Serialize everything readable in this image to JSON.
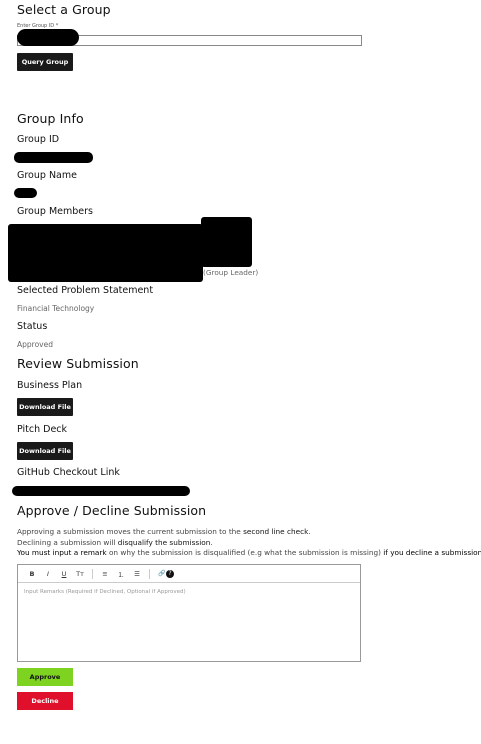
{
  "select_group": {
    "title": "Select a Group",
    "input_label": "Enter Group ID *",
    "query_button": "Query Group"
  },
  "group_info": {
    "title": "Group Info",
    "group_id_label": "Group ID",
    "group_name_label": "Group Name",
    "members_label": "Group Members",
    "leader_tag": "(Group Leader)",
    "problem_label": "Selected Problem Statement",
    "problem_value": "Financial Technology",
    "status_label": "Status",
    "status_value": "Approved"
  },
  "review": {
    "title": "Review Submission",
    "business_plan_label": "Business Plan",
    "pitch_deck_label": "Pitch Deck",
    "download_label": "Download File",
    "github_label": "GitHub Checkout Link"
  },
  "decision": {
    "title": "Approve / Decline Submission",
    "line1_pre": "Approving a submission moves the current submission to the ",
    "line1_em": "second line check",
    "line1_post": ".",
    "line2_pre": "Declining a submission will ",
    "line2_em": "disqualify the submission",
    "line2_post": ".",
    "line3_em1": "You must input a remark",
    "line3_mid": " on why the submission is disqualified (e.g what the submission is missing) ",
    "line3_em2": "if you decline a submission",
    "line3_post": ".",
    "toolbar": [
      "B",
      "I",
      "U",
      "Tт",
      "≡",
      "⒈",
      "☰",
      "🔗",
      "?"
    ],
    "remarks_placeholder": "Input Remarks (Required if Declined, Optional if Approved)",
    "approve_button": "Approve",
    "decline_button": "Decline"
  },
  "colors": {
    "approve": "#7ed321",
    "decline": "#e0102c",
    "dark_button": "#1a1a1a"
  }
}
